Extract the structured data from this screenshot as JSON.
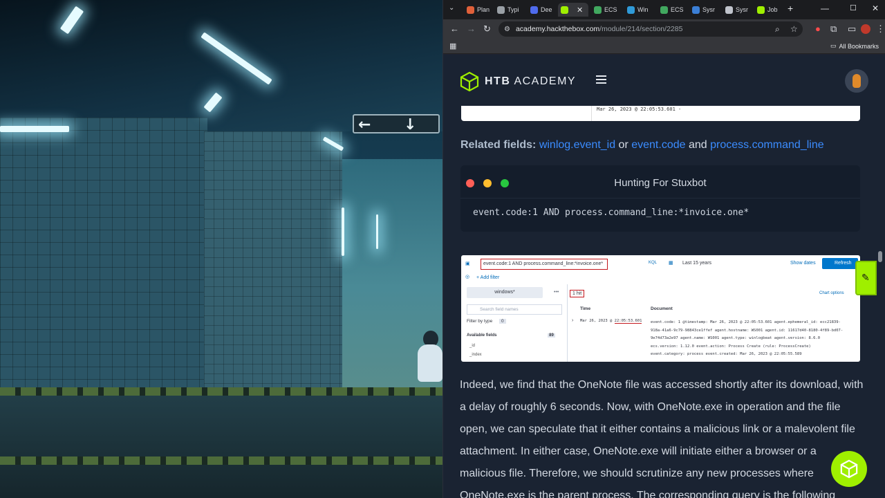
{
  "browser": {
    "tabs": [
      {
        "label": "Plan",
        "color": "#e0603a"
      },
      {
        "label": "Typi",
        "color": "#9aa0a6"
      },
      {
        "label": "Dee",
        "color": "#4f6bed"
      },
      {
        "label": "",
        "color": "#9fef00"
      },
      {
        "label": "ECS",
        "color": "#41a85f"
      },
      {
        "label": "Win",
        "color": "#2f9ad8"
      },
      {
        "label": "ECS",
        "color": "#41a85f"
      },
      {
        "label": "Sysr",
        "color": "#3b7fd6"
      },
      {
        "label": "Sysr",
        "color": "#c0c4cc"
      },
      {
        "label": "Job",
        "color": "#9fef00"
      }
    ],
    "url_host": "academy.hackthebox.com",
    "url_path": "/module/214/section/2285",
    "all_bookmarks": "All Bookmarks"
  },
  "header": {
    "logo_bold": "HTB",
    "logo_rest": " ACADEMY"
  },
  "top_card": {
    "row": "Mar 26, 2023 @ 22:05:53.601   -"
  },
  "related": {
    "label": "Related fields:",
    "field1": "winlog.event_id",
    "or": " or ",
    "field2": "event.code",
    "and": " and ",
    "field3": "process.command_line"
  },
  "code_block": {
    "title": "Hunting For Stuxbot",
    "code": "event.code:1 AND process.command_line:*invoice.one*",
    "dot_colors": [
      "#ff5f57",
      "#ffbd2e",
      "#28c840"
    ]
  },
  "kibana": {
    "query": "event.code:1 AND process.command_line:*invoice.one*",
    "kql": "KQL",
    "range": "Last 15 years",
    "show_dates": "Show dates",
    "refresh": "Refresh",
    "add_filter": "+ Add filter",
    "index": "windows*",
    "hits": "1 hit",
    "chart_options": "Chart options",
    "search_placeholder": "Search field names",
    "filter_by_type": "Filter by type",
    "filter_count": "0",
    "available_fields": "Available fields",
    "available_count": "89",
    "fields": [
      "_id",
      "_index"
    ],
    "col_time": "Time",
    "col_document": "Document",
    "time_prefix": "Mar 26, 2023 @ ",
    "time_value": "22:05:53.601",
    "doc_lines": [
      "event.code: 1  @timestamp: Mar 26, 2023 @ 22:05:53.601  agent.ephemeral_id: ecc21839-",
      "918a-41a6-9c79-98843ce1ffef  agent.hostname: WS001  agent.id: 11617d40-8180-4f89-bd07-",
      "9e74d73a2e97  agent.name: WS001  agent.type: winlogbeat  agent.version: 8.6.0",
      "ecs.version: 1.12.0  event.action: Process Create (rule: ProcessCreate)",
      "event.category: process  event.created: Mar 26, 2023 @ 22:05:55.589"
    ]
  },
  "prose": "Indeed, we find that the OneNote file was accessed shortly after its download, with a delay of roughly 6 seconds. Now, with OneNote.exe in operation and the file open, we can speculate that it either contains a malicious link or a malevolent file attachment. In either case, OneNote.exe will initiate either a browser or a malicious file. Therefore, we should scrutinize any new processes where OneNote.exe is the parent process. The corresponding query is the following"
}
